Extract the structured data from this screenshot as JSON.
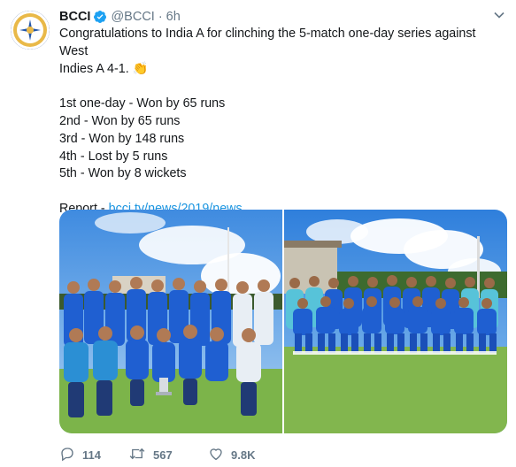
{
  "account": {
    "name": "BCCI",
    "handle": "@BCCI",
    "separator": "·",
    "time": "6h"
  },
  "tweet": {
    "line1": "Congratulations to India A for clinching the 5-match one-day series against West",
    "line2": "Indies A 4-1. 👏",
    "results": [
      "1st one-day - Won by 65 runs",
      "2nd - Won by 65 runs",
      "3rd - Won by 148 runs",
      "4th - Lost by 5 runs",
      "5th - Won by 8 wickets"
    ],
    "report_label": "Report - ",
    "report_link": "bcci.tv/news/2019/news…"
  },
  "actions": {
    "replies": "114",
    "retweets": "567",
    "likes": "9.8K"
  },
  "icons": {
    "verified": "verified-badge-icon",
    "caret": "chevron-down-icon",
    "reply": "reply-icon",
    "retweet": "retweet-icon",
    "like": "heart-icon"
  },
  "colors": {
    "link": "#1b95e0",
    "secondary_text": "#657786",
    "team_blue": "#1f5fd1"
  }
}
